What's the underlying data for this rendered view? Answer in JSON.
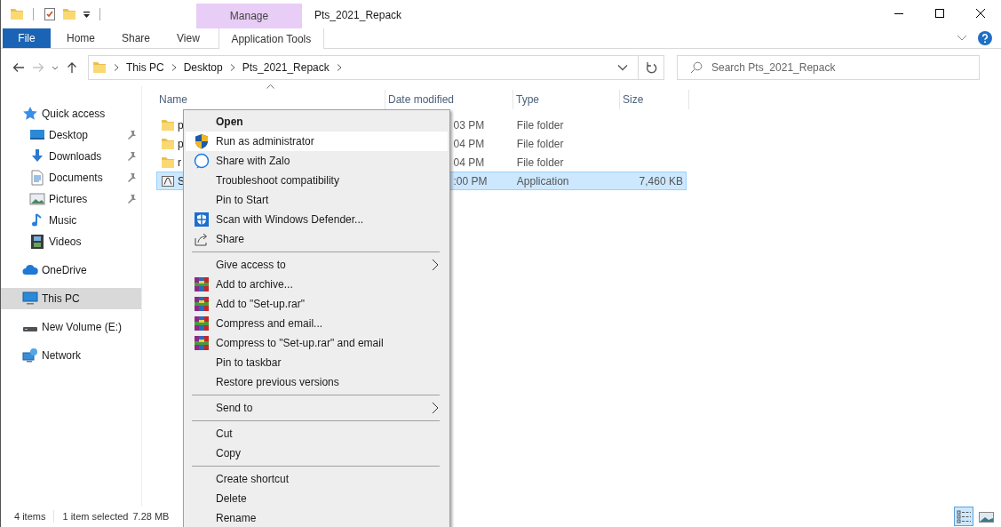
{
  "window": {
    "title": "Pts_2021_Repack"
  },
  "ribbon": {
    "context_group": {
      "label": "Manage"
    },
    "tabs": [
      {
        "kind": "file",
        "label": "File",
        "selected": false
      },
      {
        "kind": "tab",
        "label": "Home",
        "selected": false
      },
      {
        "kind": "tab",
        "label": "Share",
        "selected": false
      },
      {
        "kind": "tab",
        "label": "View",
        "selected": false
      },
      {
        "kind": "context",
        "label": "Application Tools",
        "selected": false
      }
    ]
  },
  "address": {
    "breadcrumbs": [
      "This PC",
      "Desktop",
      "Pts_2021_Repack"
    ]
  },
  "search": {
    "placeholder": "Search Pts_2021_Repack"
  },
  "sidebar": {
    "items": [
      {
        "label": "Quick access",
        "selected": false,
        "children": [
          {
            "label": "Desktop",
            "pinned": true,
            "selected": false
          },
          {
            "label": "Downloads",
            "pinned": true,
            "selected": false
          },
          {
            "label": "Documents",
            "pinned": true,
            "selected": false
          },
          {
            "label": "Pictures",
            "pinned": true,
            "selected": false
          },
          {
            "label": "Music",
            "pinned": false,
            "selected": false
          },
          {
            "label": "Videos",
            "pinned": false,
            "selected": false
          }
        ]
      },
      {
        "label": "OneDrive",
        "selected": false
      },
      {
        "label": "This PC",
        "selected": true
      },
      {
        "label": "New Volume (E:)",
        "selected": false
      },
      {
        "label": "Network",
        "selected": false
      }
    ]
  },
  "table": {
    "columns": [
      "Name",
      "Date modified",
      "Type",
      "Size"
    ],
    "rows": [
      {
        "kind": "folder",
        "name": "p",
        "date": "03 PM",
        "type": "File folder",
        "selected": false
      },
      {
        "kind": "folder",
        "name": "p",
        "date": "04 PM",
        "type": "File folder",
        "selected": false
      },
      {
        "kind": "folder",
        "name": "r",
        "date": "04 PM",
        "type": "File folder",
        "selected": false
      },
      {
        "kind": "app",
        "name": "S",
        "date": ":00 PM",
        "type": "Application",
        "size": "7,460 KB",
        "selected": true
      }
    ]
  },
  "context_menu": {
    "items": [
      {
        "kind": "item",
        "label": "Open",
        "default": true,
        "submenu": false,
        "selected": false
      },
      {
        "kind": "item",
        "label": "Run as administrator",
        "default": false,
        "submenu": false,
        "selected": true
      },
      {
        "kind": "item",
        "label": "Share with Zalo",
        "default": false,
        "submenu": false,
        "selected": false
      },
      {
        "kind": "item",
        "label": "Troubleshoot compatibility",
        "default": false,
        "submenu": false,
        "selected": false
      },
      {
        "kind": "item",
        "label": "Pin to Start",
        "default": false,
        "submenu": false,
        "selected": false
      },
      {
        "kind": "item",
        "label": "Scan with Windows Defender...",
        "default": false,
        "submenu": false,
        "selected": false
      },
      {
        "kind": "item",
        "label": "Share",
        "default": false,
        "submenu": false,
        "selected": false
      },
      {
        "kind": "separator"
      },
      {
        "kind": "item",
        "label": "Give access to",
        "default": false,
        "submenu": true,
        "selected": false
      },
      {
        "kind": "item",
        "label": "Add to archive...",
        "default": false,
        "submenu": false,
        "selected": false
      },
      {
        "kind": "item",
        "label": "Add to \"Set-up.rar\"",
        "default": false,
        "submenu": false,
        "selected": false
      },
      {
        "kind": "item",
        "label": "Compress and email...",
        "default": false,
        "submenu": false,
        "selected": false
      },
      {
        "kind": "item",
        "label": "Compress to \"Set-up.rar\" and email",
        "default": false,
        "submenu": false,
        "selected": false
      },
      {
        "kind": "item",
        "label": "Pin to taskbar",
        "default": false,
        "submenu": false,
        "selected": false
      },
      {
        "kind": "item",
        "label": "Restore previous versions",
        "default": false,
        "submenu": false,
        "selected": false
      },
      {
        "kind": "separator"
      },
      {
        "kind": "item",
        "label": "Send to",
        "default": false,
        "submenu": true,
        "selected": false
      },
      {
        "kind": "separator"
      },
      {
        "kind": "item",
        "label": "Cut",
        "default": false,
        "submenu": false,
        "selected": false
      },
      {
        "kind": "item",
        "label": "Copy",
        "default": false,
        "submenu": false,
        "selected": false
      },
      {
        "kind": "separator"
      },
      {
        "kind": "item",
        "label": "Create shortcut",
        "default": false,
        "submenu": false,
        "selected": false
      },
      {
        "kind": "item",
        "label": "Delete",
        "default": false,
        "submenu": false,
        "selected": false
      },
      {
        "kind": "item",
        "label": "Rename",
        "default": false,
        "submenu": false,
        "selected": false
      }
    ]
  },
  "status_bar": {
    "item_count": "4 items",
    "selection": "1 item selected",
    "size": "7.28 MB",
    "views": [
      {
        "kind": "details",
        "selected": true
      },
      {
        "kind": "large-icons",
        "selected": false
      }
    ]
  }
}
